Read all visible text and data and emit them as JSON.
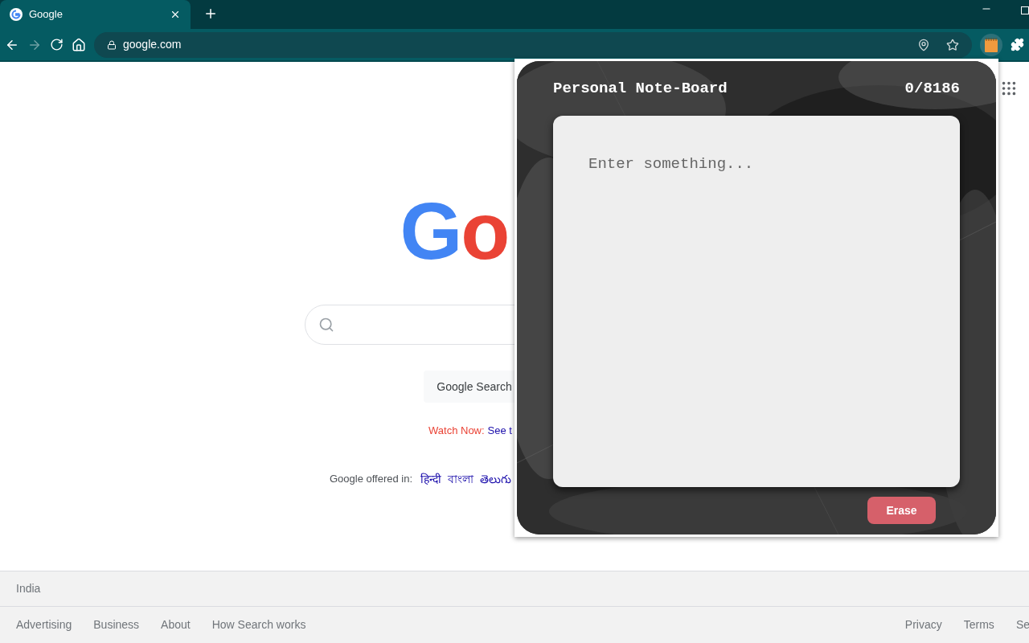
{
  "browser": {
    "tab": {
      "title": "Google",
      "selected": true
    },
    "address": "google.com",
    "back_disabled": false,
    "forward_disabled": true,
    "extension_active": true
  },
  "page": {
    "logo": [
      {
        "letter": "G",
        "color": "#4285f4"
      },
      {
        "letter": "o",
        "color": "#ea4335"
      }
    ],
    "search_button": "Google Search",
    "promo": {
      "label": "Watch Now:",
      "link": "See t"
    },
    "languages_label": "Google offered in:",
    "languages": [
      "हिन्दी",
      "বাংলা",
      "తెలుగు"
    ],
    "footer": {
      "country": "India",
      "left_links": [
        "Advertising",
        "Business",
        "About",
        "How Search works"
      ],
      "right_links": [
        "Privacy",
        "Terms",
        "Se"
      ]
    }
  },
  "popup": {
    "title": "Personal Note-Board",
    "counter": "0/8186",
    "note": {
      "placeholder": "Enter something..."
    },
    "erase_button": "Erase"
  }
}
